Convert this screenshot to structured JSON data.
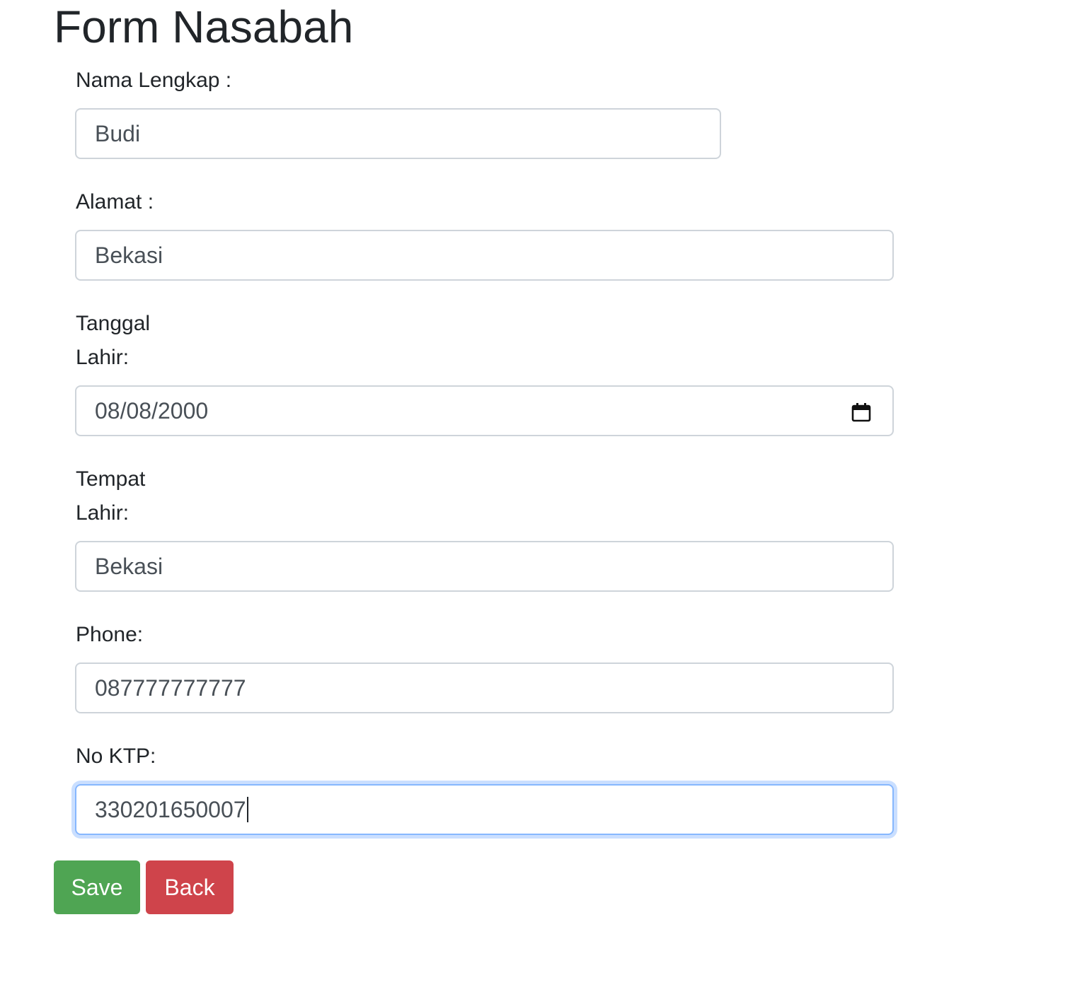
{
  "page": {
    "title": "Form Nasabah"
  },
  "form": {
    "nama": {
      "label": "Nama Lengkap :",
      "value": "Budi"
    },
    "alamat": {
      "label": "Alamat :",
      "value": "Bekasi"
    },
    "tanggal_lahir": {
      "label_line1": "Tanggal",
      "label_line2": "Lahir:",
      "value": "08/08/2000"
    },
    "tempat_lahir": {
      "label_line1": "Tempat",
      "label_line2": "Lahir:",
      "value": "Bekasi"
    },
    "phone": {
      "label": "Phone:",
      "value": "087777777777"
    },
    "ktp": {
      "label": "No KTP:",
      "value": "330201650007"
    }
  },
  "buttons": {
    "save": "Save",
    "back": "Back"
  },
  "colors": {
    "save": "#4fa553",
    "back": "#cf444b",
    "input_border": "#ced4da",
    "focus_border": "#86b7fe"
  }
}
